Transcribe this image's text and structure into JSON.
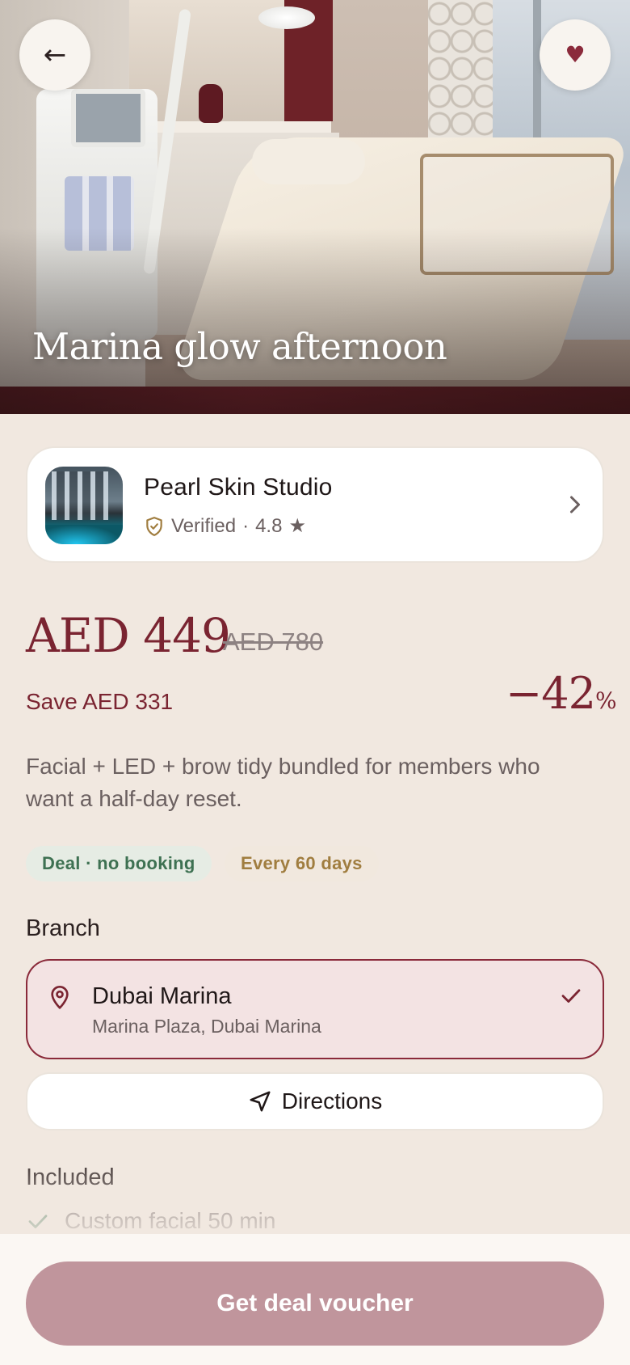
{
  "hero": {
    "title": "Marina glow afternoon"
  },
  "actions": {
    "back_icon": "arrow-left-icon",
    "favorite_icon": "heart-icon",
    "favorite_color": "#8b2a3b"
  },
  "studio": {
    "name": "Pearl Skin Studio",
    "verified_label": "Verified",
    "separator": "·",
    "rating": "4.8",
    "rating_icon": "star-icon"
  },
  "pricing": {
    "current": "AED 449",
    "original": "AED 780",
    "savings": "Save AED 331",
    "discount_value": "−42",
    "discount_unit": "%"
  },
  "description": "Facial + LED + brow tidy bundled for members who want a half-day reset.",
  "tags": [
    {
      "label": "Deal · no booking"
    },
    {
      "label": "Every 60 days"
    }
  ],
  "branch": {
    "section_title": "Branch",
    "name": "Dubai Marina",
    "address": "Marina Plaza, Dubai Marina",
    "selected": true
  },
  "directions": {
    "label": "Directions"
  },
  "included": {
    "section_title": "Included",
    "items": [
      {
        "label": "Custom facial 50 min"
      }
    ]
  },
  "cta": {
    "label": "Get deal voucher"
  },
  "colors": {
    "accent": "#7a2431",
    "background": "#f1e8e0",
    "cta": "#c0959c",
    "tag_deal_text": "#3e7152",
    "tag_every_text": "#a07d3f"
  }
}
